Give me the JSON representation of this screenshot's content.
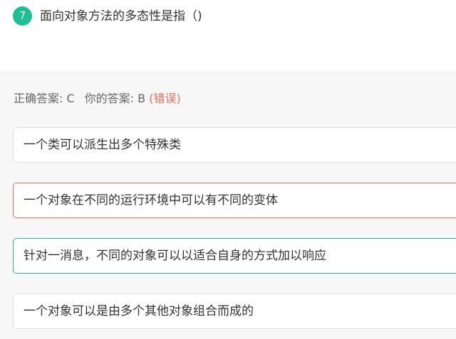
{
  "question": {
    "number": "7",
    "text": "面向对象方法的多态性是指（)"
  },
  "result": {
    "correct_label": "正确答案: C",
    "your_label": "你的答案: B",
    "status": "(错误)"
  },
  "options": [
    {
      "text": "一个类可以派生出多个特殊类"
    },
    {
      "text": "一个对象在不同的运行环境中可以有不同的变体"
    },
    {
      "text": "针对一消息，不同的对象可以以适合自身的方式加以响应"
    },
    {
      "text": "一个对象可以是由多个其他对象组合而成的"
    }
  ],
  "colors": {
    "accent": "#1dbf94",
    "error": "#ef6d57",
    "panel_bg": "#f7f7f7"
  }
}
